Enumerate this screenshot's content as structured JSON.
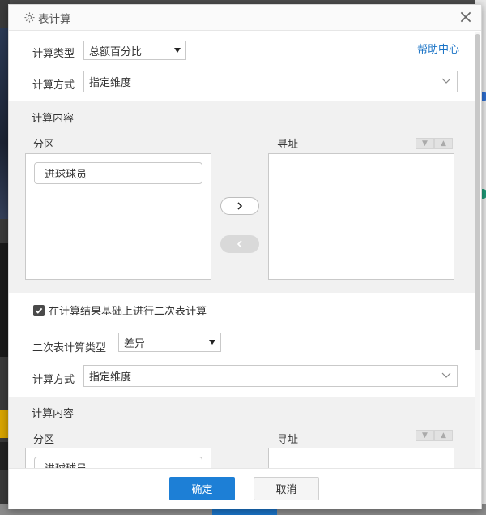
{
  "dialog": {
    "title": "表计算",
    "help_link": "帮助中心"
  },
  "primary": {
    "calc_type_label": "计算类型",
    "calc_type_value": "总额百分比",
    "calc_method_label": "计算方式",
    "calc_method_value": "指定维度"
  },
  "content1": {
    "title": "计算内容",
    "partition_label": "分区",
    "addressing_label": "寻址",
    "partition_items": [
      "进球球员"
    ]
  },
  "secondary_toggle": {
    "label": "在计算结果基础上进行二次表计算",
    "checked": true
  },
  "secondary": {
    "calc_type_label": "二次表计算类型",
    "calc_type_value": "差异",
    "calc_method_label": "计算方式",
    "calc_method_value": "指定维度"
  },
  "content2": {
    "title": "计算内容",
    "partition_label": "分区",
    "addressing_label": "寻址",
    "partition_items": [
      "进球球员"
    ]
  },
  "footer": {
    "ok_label": "确定",
    "cancel_label": "取消"
  },
  "colors": {
    "accent": "#1d7fd6",
    "link": "#1a73c6",
    "section_bg": "#f1f1f1"
  }
}
